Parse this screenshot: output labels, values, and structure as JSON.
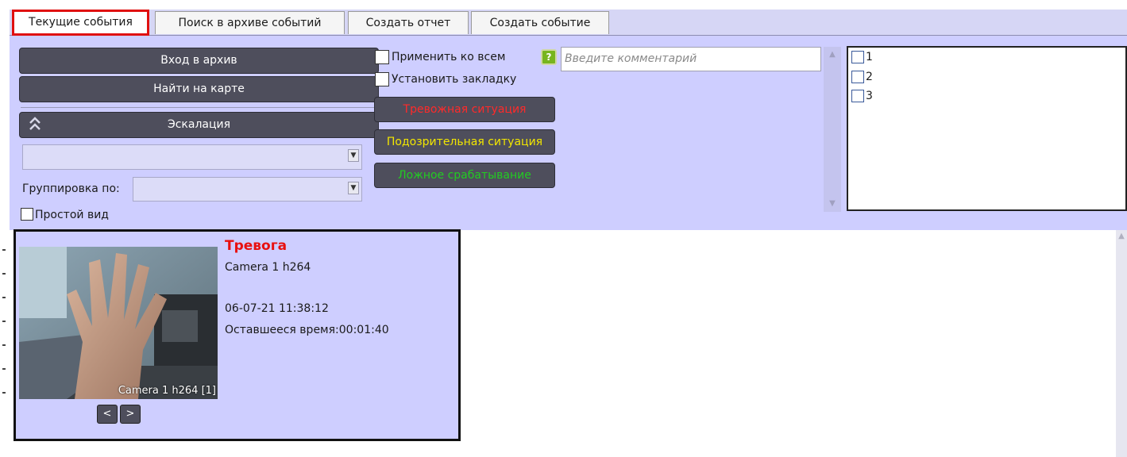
{
  "tabs": [
    {
      "label": "Текущие события"
    },
    {
      "label": "Поиск в архиве событий"
    },
    {
      "label": "Создать отчет"
    },
    {
      "label": "Создать событие"
    }
  ],
  "actions": {
    "archive_label": "Вход в архив",
    "map_label": "Найти на карте",
    "escalation_label": "Эскалация"
  },
  "filters": {
    "grouping_label": "Группировка по:",
    "simple_view_label": "Простой вид"
  },
  "options": {
    "apply_all_label": "Применить ко всем",
    "bookmark_label": "Установить закладку"
  },
  "reactions": {
    "alarm_label": "Тревожная ситуация",
    "alarm_color": "#ff2a2a",
    "suspicious_label": "Подозрительная ситуация",
    "suspicious_color": "#f2e600",
    "false_label": "Ложное срабатывание",
    "false_color": "#22cc22"
  },
  "comment": {
    "help_glyph": "?",
    "placeholder": "Введите комментарий"
  },
  "list_items": [
    {
      "label": "1"
    },
    {
      "label": "2"
    },
    {
      "label": "3"
    }
  ],
  "alarm": {
    "title": "Тревога",
    "camera": "Camera 1 h264",
    "timestamp": "06-07-21 11:38:12",
    "remaining_label": "Оставшееся время:",
    "remaining_value": "00:01:40",
    "video_caption": "Camera 1 h264 [1]",
    "prev_label": "<",
    "next_label": ">"
  }
}
